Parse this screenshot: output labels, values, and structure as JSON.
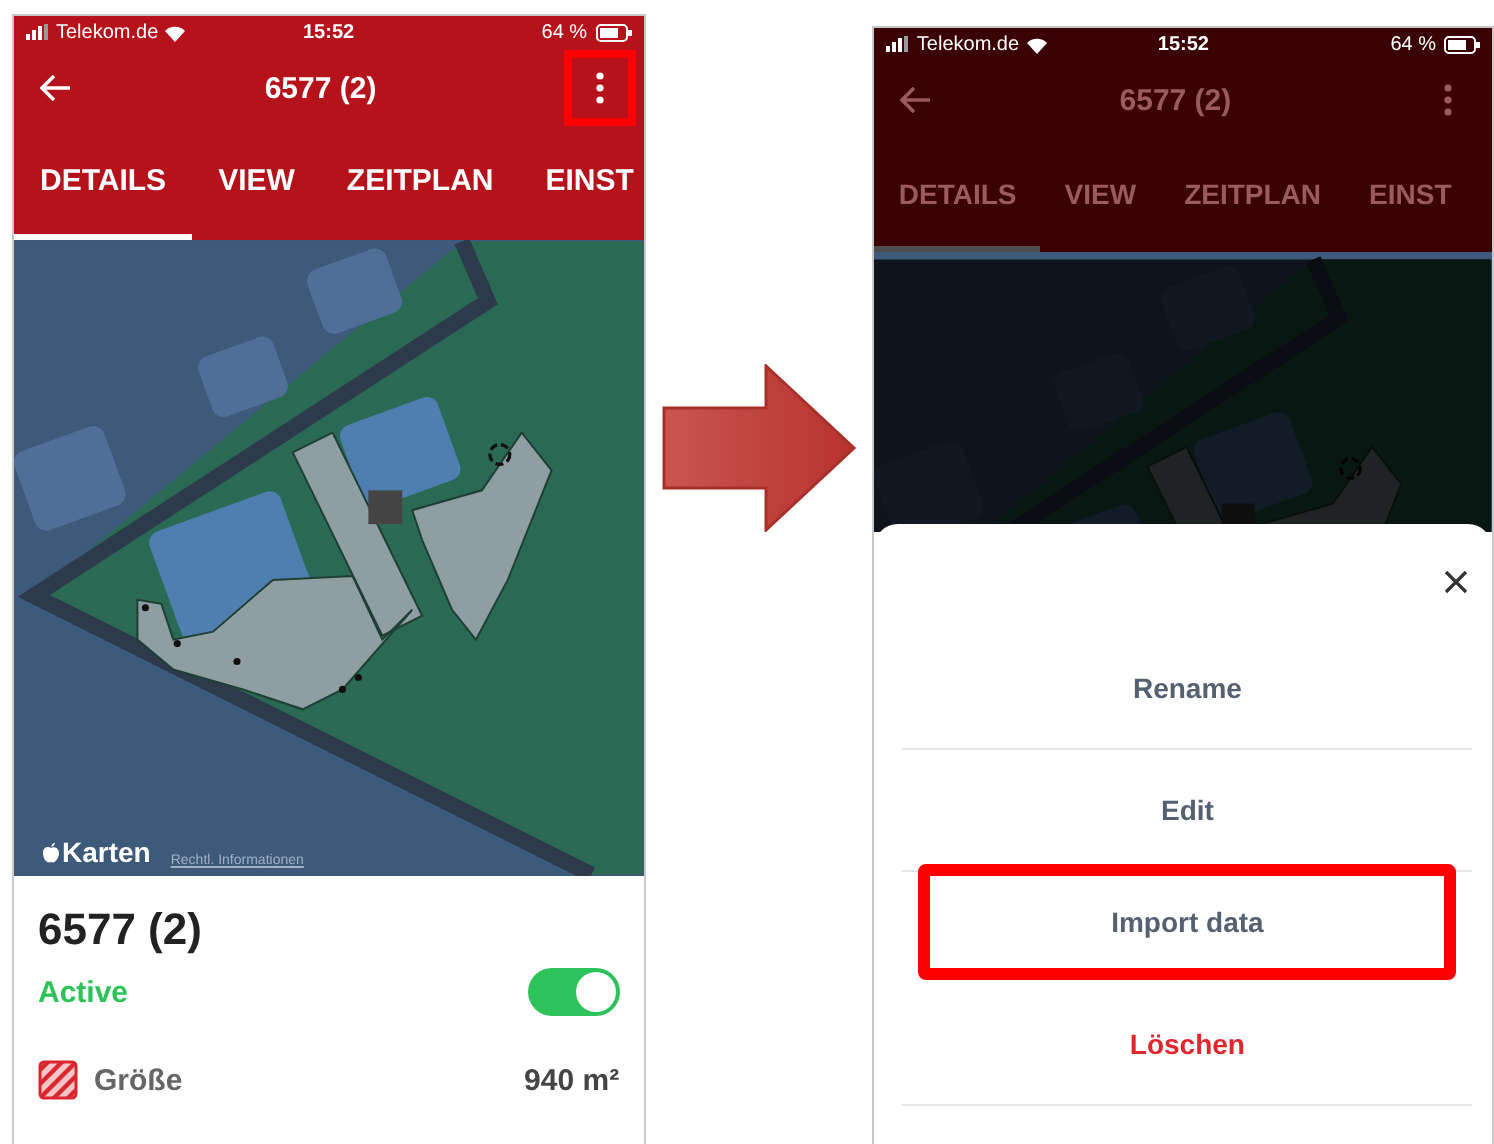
{
  "screens": [
    {
      "dimmed": false,
      "status_bar": {
        "carrier": "Telekom.de",
        "time": "15:52",
        "battery": "64 %"
      },
      "app_bar": {
        "title": "6577 (2)",
        "menu_highlighted": true
      },
      "tabs": [
        {
          "label": "DETAILS",
          "selected": true
        },
        {
          "label": "VIEW",
          "selected": false
        },
        {
          "label": "ZEITPLAN",
          "selected": false
        },
        {
          "label": "EINST",
          "selected": false
        }
      ],
      "map": {
        "brand": "Karten",
        "legal_link": "Rechtl. Informationen"
      },
      "detail": {
        "name": "6577 (2)",
        "status": "Active",
        "toggle_on": true,
        "size_label": "Größe",
        "size_value": "940 m²"
      }
    },
    {
      "dimmed": true,
      "status_bar": {
        "carrier": "Telekom.de",
        "time": "15:52",
        "battery": "64 %"
      },
      "app_bar": {
        "title": "6577 (2)",
        "menu_highlighted": false
      },
      "tabs": [
        {
          "label": "DETAILS",
          "selected": true
        },
        {
          "label": "VIEW",
          "selected": false
        },
        {
          "label": "ZEITPLAN",
          "selected": false
        },
        {
          "label": "EINST",
          "selected": false
        }
      ],
      "sheet": {
        "items": [
          {
            "label": "Rename",
            "kind": "normal",
            "highlighted": false
          },
          {
            "label": "Edit",
            "kind": "normal",
            "highlighted": false
          },
          {
            "label": "Import data",
            "kind": "normal",
            "highlighted": true
          },
          {
            "label": "Löschen",
            "kind": "danger",
            "highlighted": false
          }
        ]
      }
    }
  ]
}
